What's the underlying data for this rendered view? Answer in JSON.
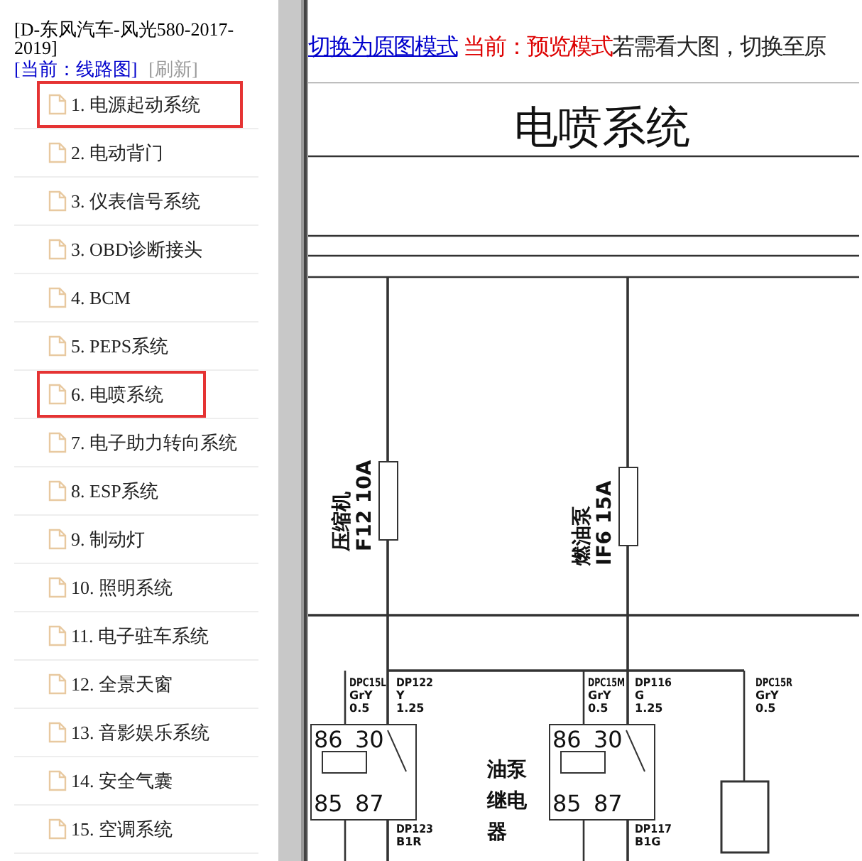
{
  "sidebar": {
    "title": "[D-东风汽车-风光580-2017-2019]",
    "current": "[当前：线路图]",
    "refresh": "[刷新]",
    "items": [
      {
        "label": "1. 电源起动系统",
        "highlighted": true
      },
      {
        "label": "2. 电动背门",
        "highlighted": false
      },
      {
        "label": "3. 仪表信号系统",
        "highlighted": false
      },
      {
        "label": "3. OBD诊断接头",
        "highlighted": false
      },
      {
        "label": "4. BCM",
        "highlighted": false
      },
      {
        "label": "5. PEPS系统",
        "highlighted": false
      },
      {
        "label": "6. 电喷系统",
        "highlighted": true
      },
      {
        "label": "7. 电子助力转向系统",
        "highlighted": false
      },
      {
        "label": "8. ESP系统",
        "highlighted": false
      },
      {
        "label": "9. 制动灯",
        "highlighted": false
      },
      {
        "label": "10. 照明系统",
        "highlighted": false
      },
      {
        "label": "11. 电子驻车系统",
        "highlighted": false
      },
      {
        "label": "12. 全景天窗",
        "highlighted": false
      },
      {
        "label": "13. 音影娱乐系统",
        "highlighted": false
      },
      {
        "label": "14. 安全气囊",
        "highlighted": false
      },
      {
        "label": "15. 空调系统",
        "highlighted": false
      }
    ]
  },
  "mode_bar": {
    "switch_link": "切换为原图模式",
    "current_mode": "当前：预览模式",
    "hint": "若需看大图，切换至原"
  },
  "diagram": {
    "title": "电喷系统",
    "fuses": [
      {
        "name": "压缩机",
        "rating": "F12 10A"
      },
      {
        "name": "燃油泵",
        "rating": "IF6 15A"
      }
    ],
    "relays": [
      {
        "pins": [
          "86",
          "30",
          "85",
          "87"
        ]
      },
      {
        "pins": [
          "86",
          "30",
          "85",
          "87"
        ]
      }
    ],
    "relay_name": [
      "油泵",
      "继电",
      "器"
    ],
    "wires": [
      [
        "DPC15L",
        "GrY",
        "0.5"
      ],
      [
        "DP122",
        "Y",
        "1.25"
      ],
      [
        "DPC15M",
        "GrY",
        "0.5"
      ],
      [
        "DP116",
        "G",
        "1.25"
      ],
      [
        "DPC15R",
        "GrY",
        "0.5"
      ],
      [
        "DP123",
        "B1R"
      ],
      [
        "DP117",
        "B1G"
      ]
    ]
  }
}
